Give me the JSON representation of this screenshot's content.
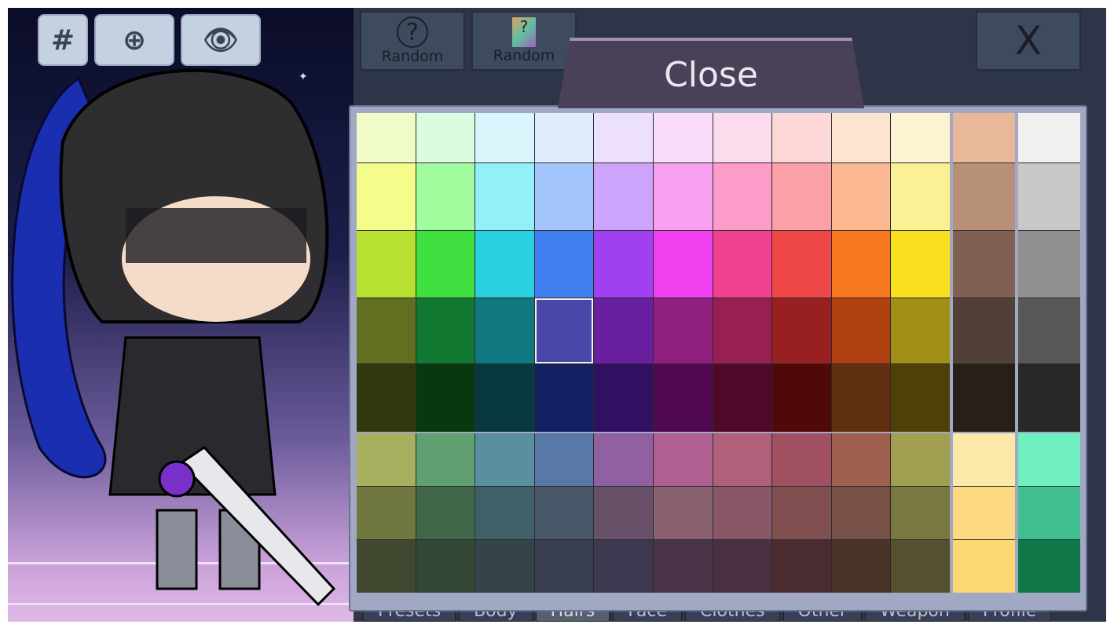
{
  "toolbar": {
    "hash_label": "#",
    "zoom_icon": "zoom-in-icon",
    "eye_icon": "eye-icon"
  },
  "top": {
    "random1_label": "Random",
    "random2_label": "Random",
    "close_x_label": "X",
    "close_label": "Close"
  },
  "tabs": [
    {
      "label": "Presets"
    },
    {
      "label": "Body"
    },
    {
      "label": "Hairs",
      "active": true
    },
    {
      "label": "Face"
    },
    {
      "label": "Clothes"
    },
    {
      "label": "Other"
    },
    {
      "label": "Weapon"
    },
    {
      "label": "Profile"
    }
  ],
  "palette": {
    "selected": [
      3,
      3
    ],
    "main": [
      [
        "#f0fcc8",
        "#dcfce0",
        "#d8f6fc",
        "#e0ecfc",
        "#ece0fc",
        "#f8dcf8",
        "#fcdcec",
        "#fcd8d8",
        "#fce4d0",
        "#fcf4d0"
      ],
      [
        "#f4fc8c",
        "#a0fc9c",
        "#94f0f8",
        "#a4c4fc",
        "#cca4fc",
        "#f8a0f0",
        "#fc9cc8",
        "#fca0a8",
        "#fcb890",
        "#fcf094"
      ],
      [
        "#b8e030",
        "#40e040",
        "#28d0e0",
        "#4080f0",
        "#a040f0",
        "#f040f0",
        "#f04090",
        "#f04848",
        "#f87820",
        "#f8e020"
      ],
      [
        "#607020",
        "#107830",
        "#107880",
        "#4848a8",
        "#6820a0",
        "#902080",
        "#982050",
        "#982020",
        "#b04010",
        "#a09018"
      ],
      [
        "#303810",
        "#083810",
        "#083840",
        "#102060",
        "#301060",
        "#500850",
        "#500828",
        "#500808",
        "#603010",
        "#504008"
      ]
    ],
    "muted": [
      [
        "#a8b060",
        "#60a070",
        "#5890a0",
        "#5878a8",
        "#9060a0",
        "#b06090",
        "#b06078",
        "#a05060",
        "#a06050",
        "#a0a050"
      ],
      [
        "#707840",
        "#406848",
        "#406068",
        "#485868",
        "#685068",
        "#886070",
        "#885868",
        "#805050",
        "#785048",
        "#787840"
      ],
      [
        "#404830",
        "#344838",
        "#344448",
        "#383e50",
        "#3e3850",
        "#4a3448",
        "#4a3040",
        "#4a2c30",
        "#4a3428",
        "#545030"
      ]
    ],
    "skin": [
      "#e8b898",
      "#b89078",
      "#806050",
      "#504038",
      "#282018"
    ],
    "gray": [
      "#f0f0f0",
      "#c8c8c8",
      "#909090",
      "#585858",
      "#282828"
    ],
    "yellow": [
      "#fce8a8",
      "#fcd880",
      "#fcd870"
    ],
    "green": [
      "#70f0c0",
      "#40c090",
      "#107848"
    ]
  }
}
